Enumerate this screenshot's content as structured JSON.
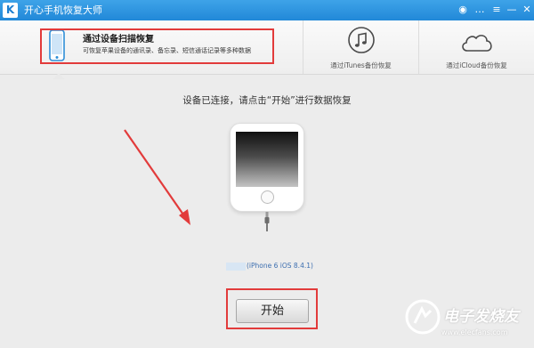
{
  "app": {
    "title": "开心手机恢复大师",
    "logo_letter": "K"
  },
  "titlebar": {
    "buttons": [
      {
        "icon": "wechat-icon",
        "glyph": "◉"
      },
      {
        "icon": "chat-icon",
        "glyph": "…"
      },
      {
        "icon": "menu-icon",
        "glyph": "≡"
      },
      {
        "icon": "minimize-icon",
        "glyph": "—"
      },
      {
        "icon": "close-icon",
        "glyph": "✕"
      }
    ]
  },
  "tabs": [
    {
      "title": "通过设备扫描恢复",
      "desc": "可恢复苹果设备的通讯录、备忘录、短信通话记录等多种数据",
      "icon": "phone-icon",
      "selected": true
    },
    {
      "label": "通过iTunes备份恢复",
      "icon": "music-note-icon"
    },
    {
      "label": "通过iCloud备份恢复",
      "icon": "cloud-icon"
    }
  ],
  "main": {
    "instruction": "设备已连接，请点击“开始”进行数据恢复",
    "device_info": "(iPhone 6 iOS 8.4.1)",
    "start_label": "开始"
  },
  "watermark": {
    "text": "电子发烧友",
    "url": "www.elecfans.com"
  },
  "colors": {
    "titlebar": "#2f96e0",
    "annotation_red": "#e23b3b"
  }
}
